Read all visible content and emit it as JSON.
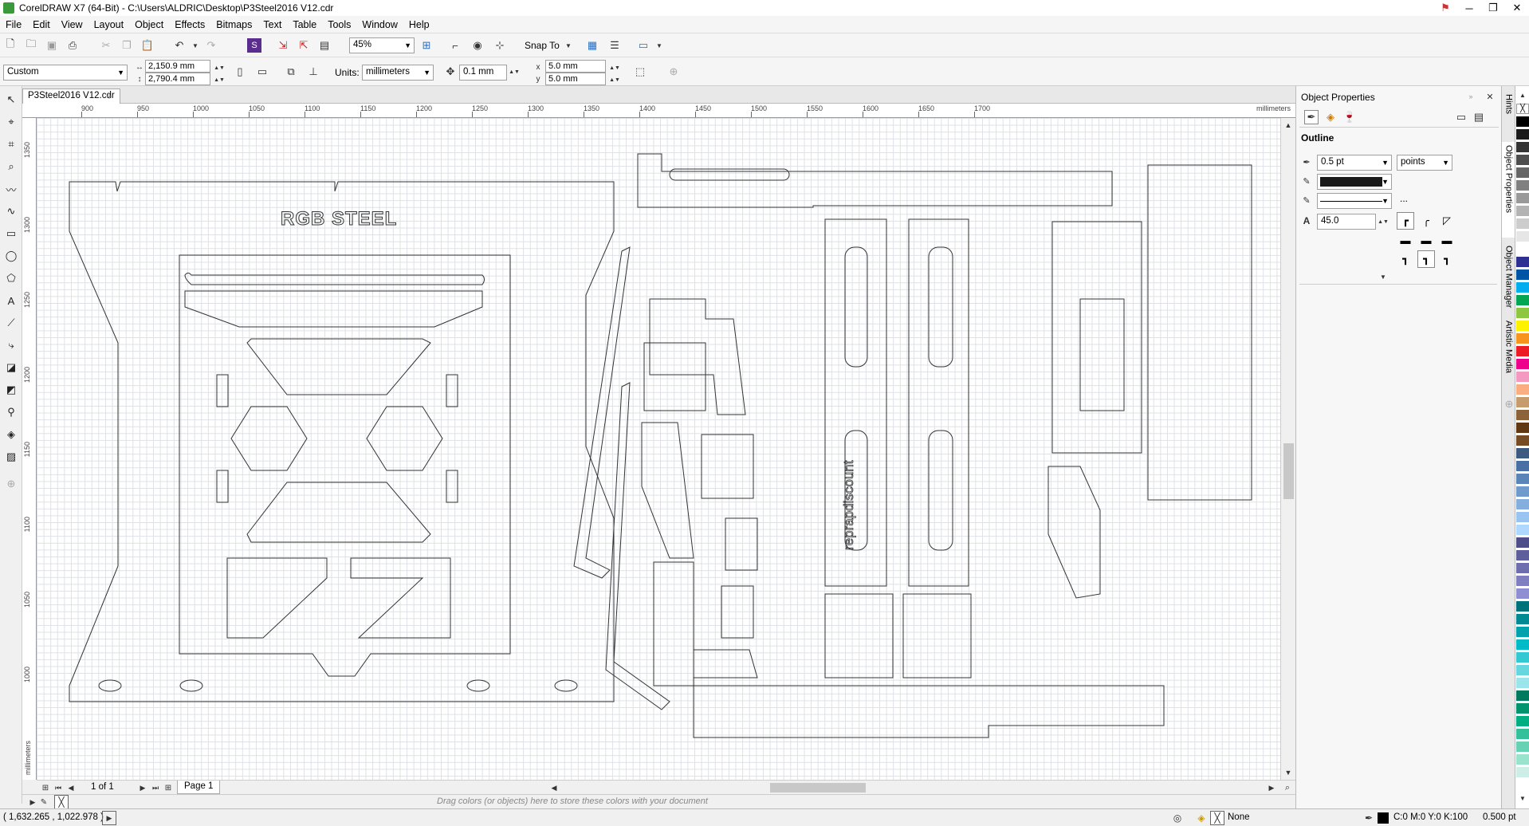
{
  "titlebar": {
    "title": "CorelDRAW X7 (64-Bit) - C:\\Users\\ALDRIC\\Desktop\\P3Steel2016 V12.cdr",
    "minimize": "─",
    "restore": "❐",
    "close": "✕"
  },
  "menu": [
    "File",
    "Edit",
    "View",
    "Layout",
    "Object",
    "Effects",
    "Bitmaps",
    "Text",
    "Table",
    "Tools",
    "Window",
    "Help"
  ],
  "toolbar1": {
    "zoom": "45%",
    "snap_to": "Snap To"
  },
  "toolbar2": {
    "page_preset": "Custom",
    "width": "2,150.9 mm",
    "height": "2,790.4 mm",
    "units_label": "Units:",
    "units": "millimeters",
    "nudge": "0.1 mm",
    "dup_x": "5.0 mm",
    "dup_y": "5.0 mm"
  },
  "document": {
    "tab": "P3Steel2016 V12.cdr",
    "page_count": "1 of 1",
    "page_tab": "Page 1"
  },
  "ruler": {
    "h_ticks": [
      "900",
      "950",
      "1000",
      "1050",
      "1100",
      "1150",
      "1200",
      "1250",
      "1300",
      "1350",
      "1400",
      "1450",
      "1500",
      "1550",
      "1600",
      "1650",
      "1700"
    ],
    "h_unit": "millimeters",
    "v_ticks": [
      "1350",
      "1300",
      "1250",
      "1200",
      "1150",
      "1100",
      "1050",
      "1000"
    ],
    "v_unit": "millimeters"
  },
  "canvas": {
    "logo_text": "RGB STEEL",
    "brand_text": "reprapdiscount"
  },
  "color_well_hint": "Drag colors (or objects) here to store these colors with your document",
  "status": {
    "coords": "( 1,632.265 , 1,022.978 )",
    "fill": "None",
    "outline_color": "C:0 M:0 Y:0 K:100",
    "outline_width": "0.500 pt"
  },
  "docker": {
    "title": "Object Properties",
    "section": "Outline",
    "width": "0.5 pt",
    "width_unit": "points",
    "miter": "45.0",
    "more": "..."
  },
  "docker_tabs": [
    "Hints",
    "Object Properties",
    "Object Manager",
    "Artistic Media"
  ],
  "palette": [
    "#ffffff",
    "#000000",
    "#1a1a1a",
    "#333333",
    "#4d4d4d",
    "#666666",
    "#808080",
    "#999999",
    "#b3b3b3",
    "#cccccc",
    "#e6e6e6",
    "#ffffff",
    "#2e3192",
    "#0054a6",
    "#00aeef",
    "#00a651",
    "#8dc63f",
    "#fff200",
    "#f7941d",
    "#ed1c24",
    "#ec008c",
    "#f49ac1",
    "#f9ad81",
    "#c69c6d",
    "#8c6239",
    "#603913",
    "#754c24",
    "#3d5a80",
    "#4a6fa5",
    "#5b85b8",
    "#6f9acb",
    "#84aede",
    "#99c3f0",
    "#aed8ff",
    "#4e4e8a",
    "#5e5e9c",
    "#6e6eae",
    "#7e7ec0",
    "#8e8ed2",
    "#00737a",
    "#008b94",
    "#00a3ad",
    "#00bbc7",
    "#33c9d3",
    "#66d7df",
    "#99e5eb",
    "#007a5e",
    "#00946f",
    "#00ae81",
    "#33c09a",
    "#66d1b3",
    "#99e3cd",
    "#cceee6"
  ]
}
